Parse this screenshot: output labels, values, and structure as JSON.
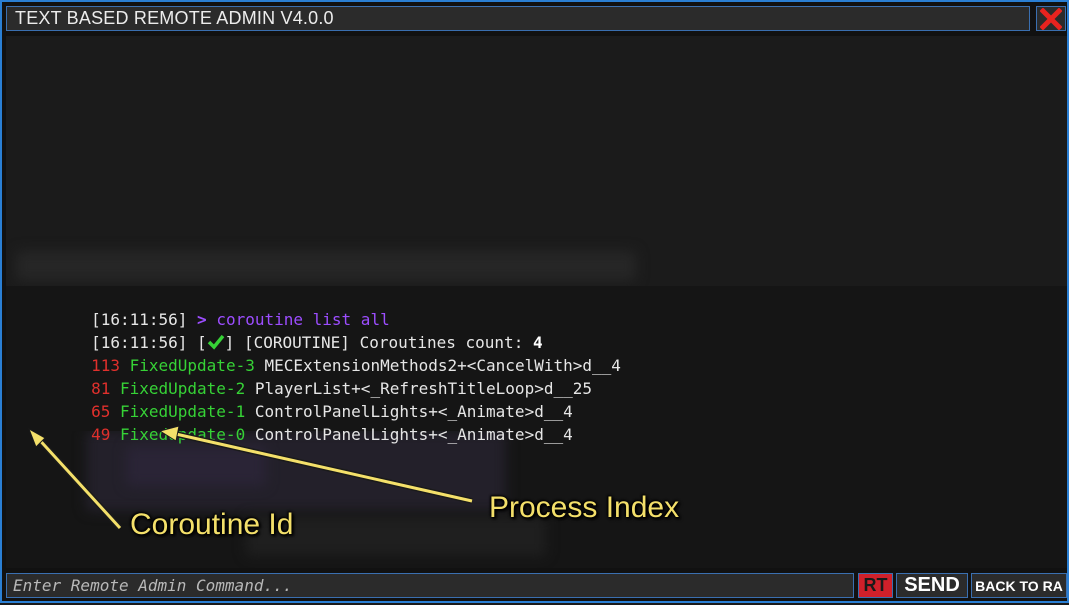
{
  "window": {
    "title": "TEXT BASED REMOTE ADMIN V4.0.0",
    "close_icon": "close-x-icon"
  },
  "colors": {
    "border_accent": "#2a7fd4",
    "command_purple": "#9c4dff",
    "id_red": "#e0302c",
    "process_green": "#36d236",
    "annotation_yellow": "#f4e06a",
    "rt_red": "#d0202a"
  },
  "console": {
    "lines": [
      {
        "timestamp": "[16:11:56]",
        "prompt": ">",
        "command": "coroutine list all"
      },
      {
        "timestamp": "[16:11:56]",
        "status_open": "[",
        "status_icon": "checkmark-icon",
        "status_close": "]",
        "tag": "[COROUTINE]",
        "message": "Coroutines count:",
        "count": "4"
      }
    ],
    "coroutines": [
      {
        "id": "113",
        "process": "FixedUpdate-3",
        "name": "MECExtensionMethods2+<CancelWith>d__4"
      },
      {
        "id": "81",
        "process": "FixedUpdate-2",
        "name": "PlayerList+<_RefreshTitleLoop>d__25"
      },
      {
        "id": "65",
        "process": "FixedUpdate-1",
        "name": "ControlPanelLights+<_Animate>d__4"
      },
      {
        "id": "49",
        "process": "FixedUpdate-0",
        "name": "ControlPanelLights+<_Animate>d__4"
      }
    ]
  },
  "annotations": {
    "coroutine_id": "Coroutine Id",
    "process_index": "Process Index"
  },
  "command_bar": {
    "placeholder": "Enter Remote Admin Command...",
    "rt_label": "RT",
    "send_label": "SEND",
    "back_label": "BACK TO RA"
  }
}
